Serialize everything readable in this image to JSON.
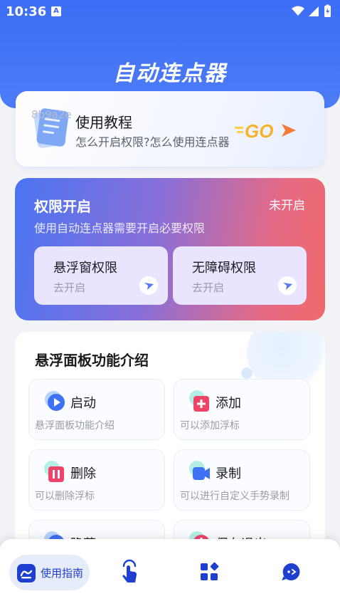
{
  "status_bar": {
    "time": "10:36",
    "notif_letter": "A"
  },
  "header": {
    "title": "自动连点器"
  },
  "tutorial": {
    "watermark": "8b9a2e",
    "title": "使用教程",
    "subtitle": "怎么开启权限?怎么使用连点器",
    "go_label": "GO"
  },
  "permissions": {
    "title": "权限开启",
    "status": "未开启",
    "description": "使用自动连点器需要开启必要权限",
    "items": [
      {
        "label": "悬浮窗权限",
        "action": "去开启"
      },
      {
        "label": "无障碍权限",
        "action": "去开启"
      }
    ]
  },
  "features": {
    "title": "悬浮面板功能介绍",
    "items": [
      {
        "label": "启动",
        "desc": "悬浮面板功能介绍",
        "icon": "play-icon"
      },
      {
        "label": "添加",
        "desc": "可以添加浮标",
        "icon": "add-icon"
      },
      {
        "label": "删除",
        "desc": "可以删除浮标",
        "icon": "delete-icon"
      },
      {
        "label": "录制",
        "desc": "可以进行自定义手势录制",
        "icon": "record-icon"
      },
      {
        "label": "隐藏",
        "desc": "",
        "icon": "hide-icon"
      },
      {
        "label": "保存退出",
        "desc": "",
        "icon": "power-icon"
      }
    ]
  },
  "bottom_nav": {
    "items": [
      {
        "label": "使用指南",
        "icon": "guide-icon",
        "active": true
      },
      {
        "label": "",
        "icon": "tap-icon"
      },
      {
        "label": "",
        "icon": "apps-icon"
      },
      {
        "label": "",
        "icon": "chat-icon"
      }
    ]
  },
  "colors": {
    "primary": "#3c6ef6",
    "accent_red": "#f16a6b",
    "nav_active": "#1e3fd0"
  }
}
